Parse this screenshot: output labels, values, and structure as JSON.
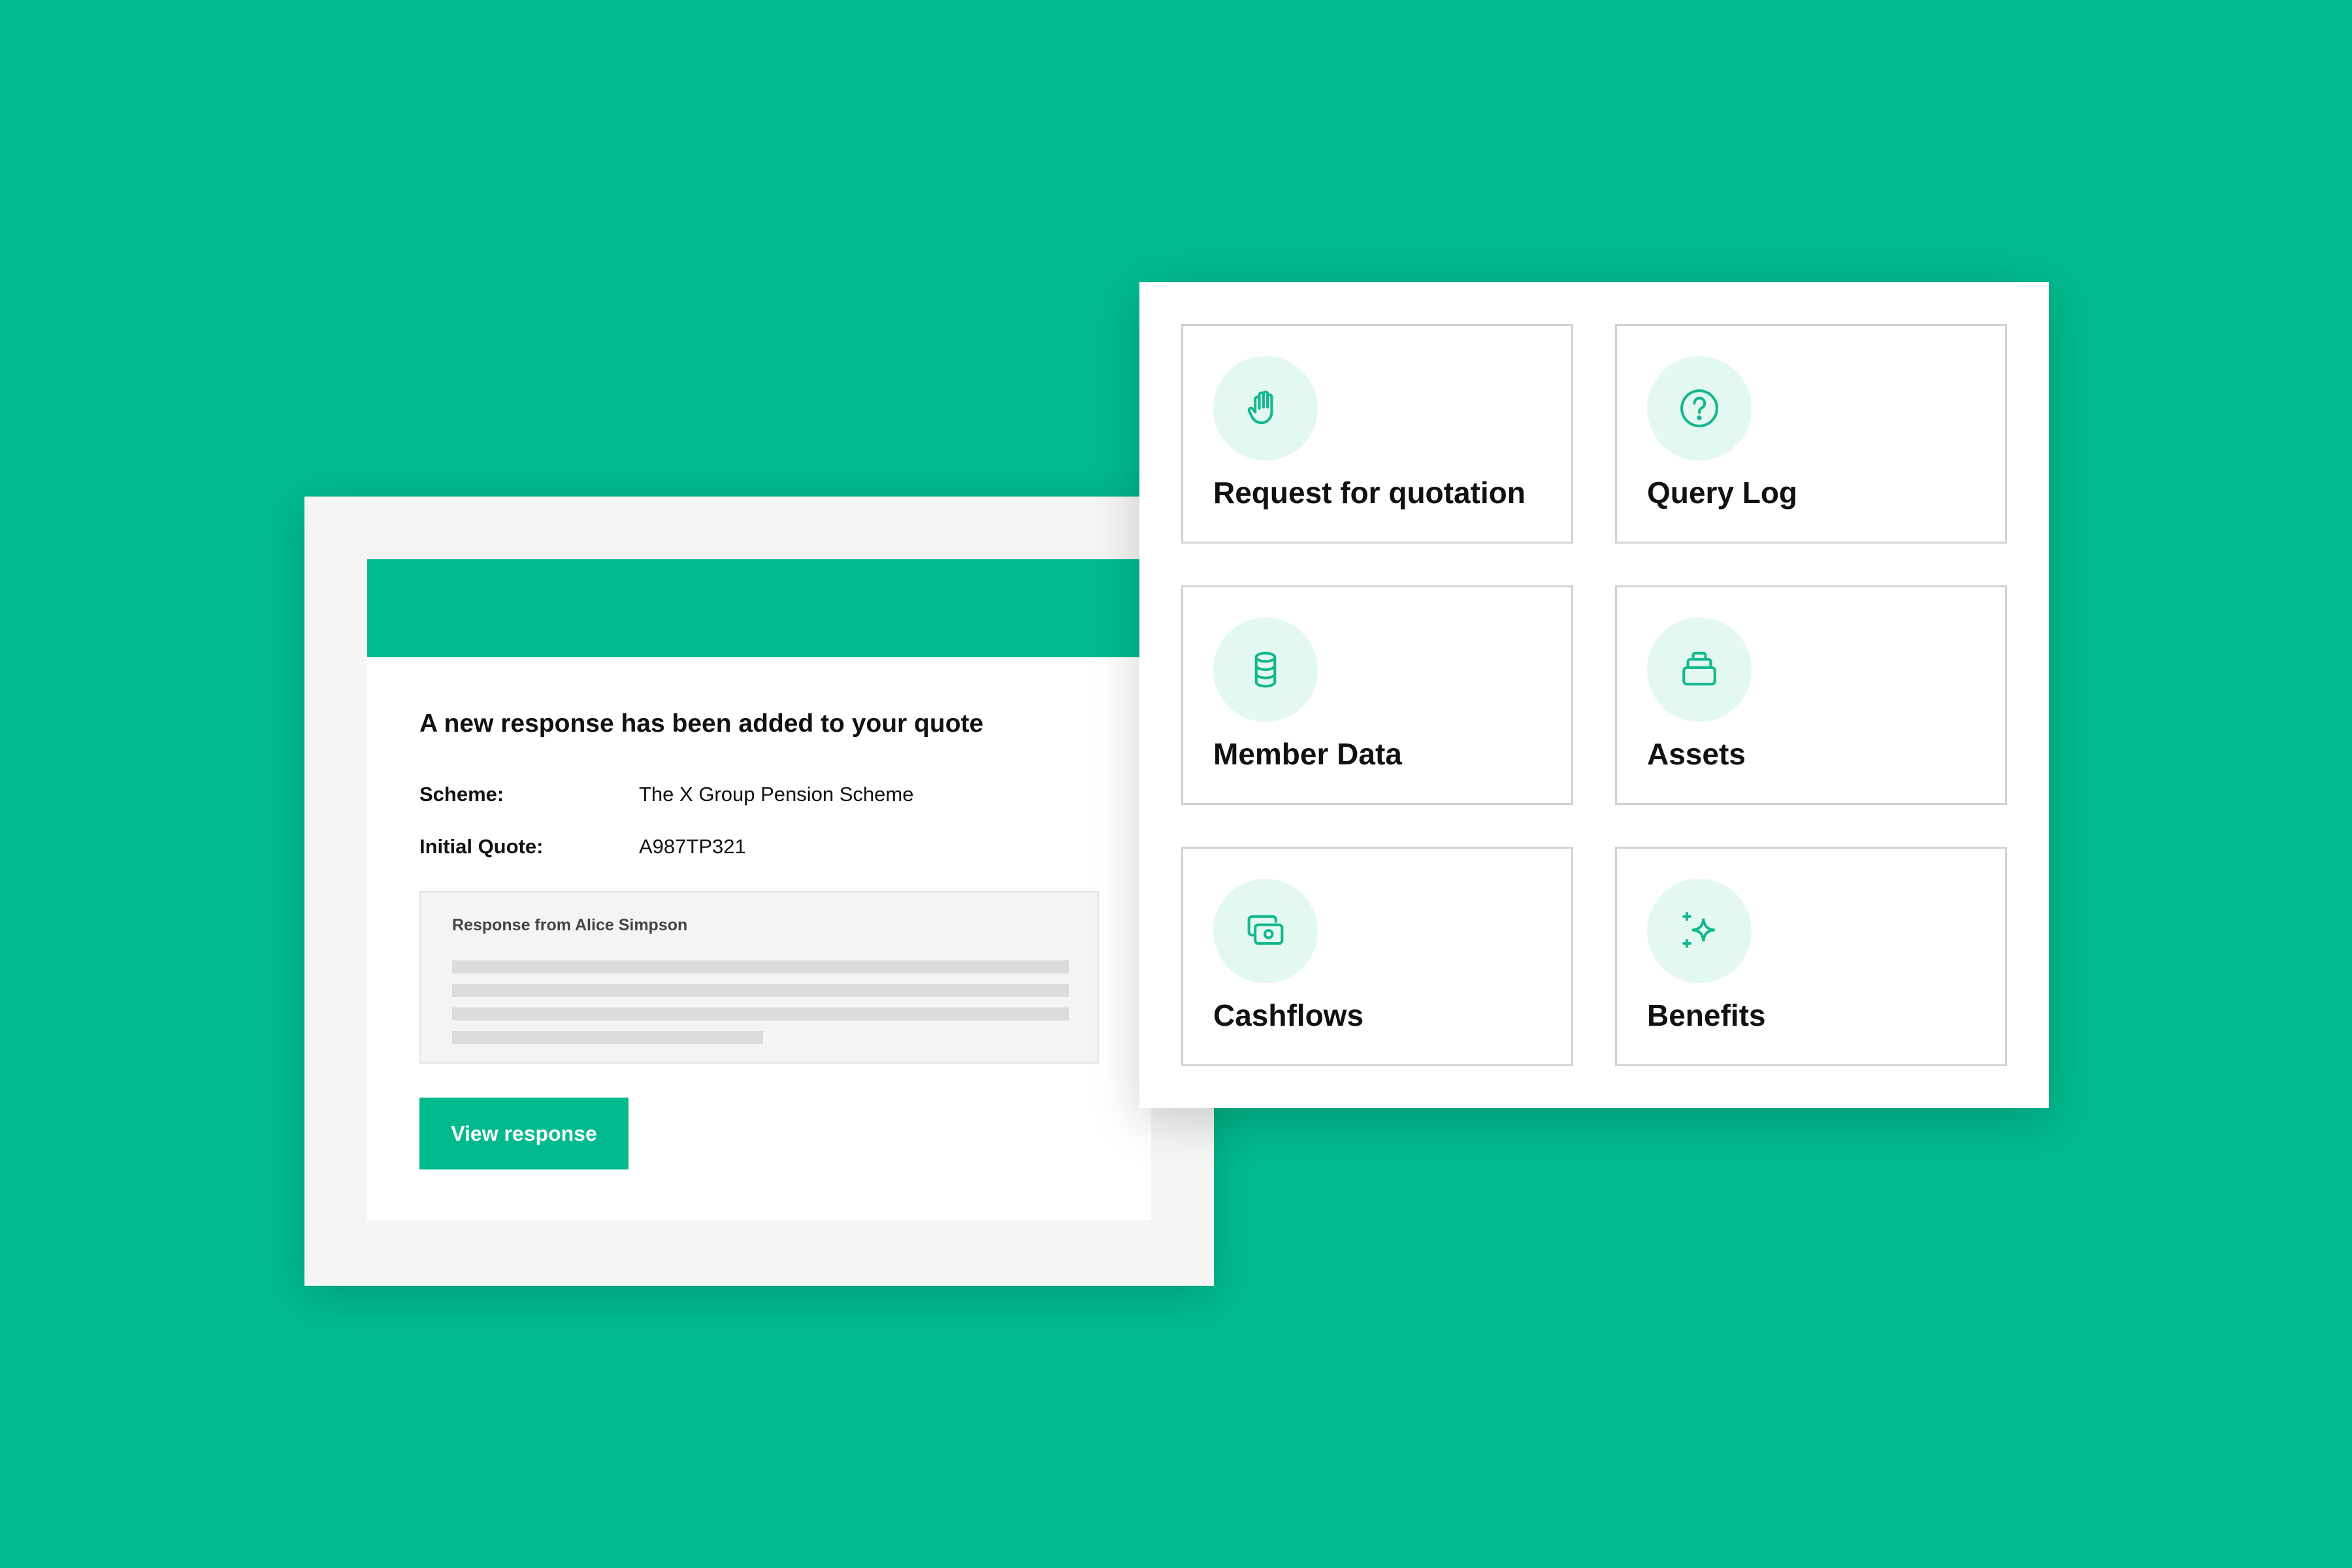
{
  "colors": {
    "background": "#00BA8E",
    "accent": "#00BA8E",
    "icon_circle": "#E4F8F2",
    "icon_stroke": "#14B88E"
  },
  "email": {
    "title": "A new response has been added to your quote",
    "scheme_label": "Scheme:",
    "scheme_value": "The X Group Pension Scheme",
    "quote_label": "Initial Quote:",
    "quote_value": "A987TP321",
    "response_from": "Response from Alice Simpson",
    "button_label": "View response"
  },
  "modules": [
    {
      "label": "Request for quotation",
      "icon": "hand-icon"
    },
    {
      "label": "Query Log",
      "icon": "question-circle-icon"
    },
    {
      "label": "Member Data",
      "icon": "database-icon"
    },
    {
      "label": "Assets",
      "icon": "stacked-boxes-icon"
    },
    {
      "label": "Cashflows",
      "icon": "cash-notes-icon"
    },
    {
      "label": "Benefits",
      "icon": "sparkles-icon"
    }
  ]
}
